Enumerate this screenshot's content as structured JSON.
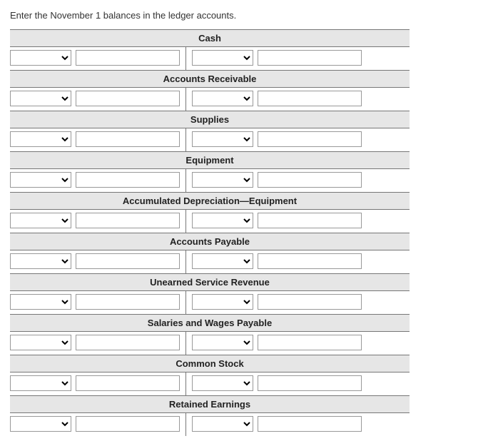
{
  "instruction": "Enter the November 1 balances in the ledger accounts.",
  "accounts": {
    "a0": "Cash",
    "a1": "Accounts Receivable",
    "a2": "Supplies",
    "a3": "Equipment",
    "a4": "Accumulated Depreciation—Equipment",
    "a5": "Accounts Payable",
    "a6": "Unearned Service Revenue",
    "a7": "Salaries and Wages Payable",
    "a8": "Common Stock",
    "a9": "Retained Earnings"
  },
  "row": {
    "select_left": "",
    "amount_left": "",
    "select_right": "",
    "amount_right": ""
  }
}
